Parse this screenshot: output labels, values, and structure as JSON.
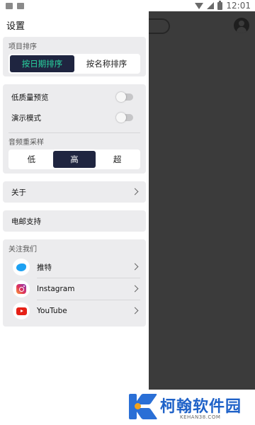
{
  "status_bar": {
    "time": "12:01"
  },
  "drawer": {
    "title": "设置",
    "sort": {
      "caption": "项目排序",
      "options": [
        "按日期排序",
        "按名称排序"
      ],
      "selected": "按日期排序"
    },
    "preferences": {
      "low_quality_preview": {
        "label": "低质量预览",
        "on": false
      },
      "demo_mode": {
        "label": "演示模式",
        "on": false
      },
      "resample": {
        "caption": "音频重采样",
        "options": [
          "低",
          "高",
          "超"
        ],
        "selected": "高"
      }
    },
    "about": {
      "label": "关于"
    },
    "email_support": {
      "label": "电邮支持"
    },
    "follow": {
      "caption": "关注我们",
      "items": [
        {
          "label": "推特",
          "icon": "twitter-icon"
        },
        {
          "label": "Instagram",
          "icon": "instagram-icon"
        },
        {
          "label": "YouTube",
          "icon": "youtube-icon"
        }
      ]
    }
  },
  "watermark": {
    "title": "柯翰软件园",
    "url": "KEHAN38.COM"
  },
  "colors": {
    "accent_dark": "#1f2540",
    "accent_green": "#28d6a0",
    "card_bg": "#ececee",
    "overlay": "#3b3b3b"
  }
}
